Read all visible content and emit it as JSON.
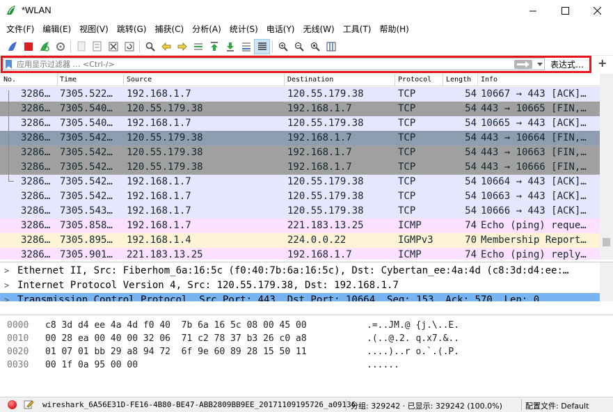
{
  "window": {
    "title": "*WLAN",
    "minimize": "minimize",
    "maximize": "maximize",
    "close": "close"
  },
  "menu": [
    "文件(F)",
    "编辑(E)",
    "视图(V)",
    "跳转(G)",
    "捕获(C)",
    "分析(A)",
    "统计(S)",
    "电话(Y)",
    "无线(W)",
    "工具(T)",
    "帮助(H)"
  ],
  "filter": {
    "placeholder": "应用显示过滤器 … <Ctrl-/>",
    "expression_label": "表达式…",
    "add_label": "+"
  },
  "packet_list": {
    "columns": [
      "No.",
      "Time",
      "Source",
      "Destination",
      "Protocol",
      "Length",
      "Info"
    ],
    "rows": [
      {
        "no": "3286…",
        "time": "7305.522…",
        "src": "192.168.1.7",
        "dst": "120.55.179.38",
        "proto": "TCP",
        "len": "54",
        "info": "10667 → 443 [ACK]…",
        "bg": "#e7e6ff",
        "fg": "#12272e"
      },
      {
        "no": "3286…",
        "time": "7305.540…",
        "src": "120.55.179.38",
        "dst": "192.168.1.7",
        "proto": "TCP",
        "len": "54",
        "info": "443 → 10665 [FIN,…",
        "bg": "#a0a0a0",
        "fg": "#12272e"
      },
      {
        "no": "3286…",
        "time": "7305.540…",
        "src": "192.168.1.7",
        "dst": "120.55.179.38",
        "proto": "TCP",
        "len": "54",
        "info": "10665 → 443 [ACK]…",
        "bg": "#e7e6ff",
        "fg": "#12272e"
      },
      {
        "no": "3286…",
        "time": "7305.542…",
        "src": "120.55.179.38",
        "dst": "192.168.1.7",
        "proto": "TCP",
        "len": "54",
        "info": "443 → 10664 [FIN,…",
        "bg": "#8c9eb0",
        "fg": "#12272e"
      },
      {
        "no": "3286…",
        "time": "7305.542…",
        "src": "120.55.179.38",
        "dst": "192.168.1.7",
        "proto": "TCP",
        "len": "54",
        "info": "443 → 10663 [FIN,…",
        "bg": "#a0a0a0",
        "fg": "#12272e"
      },
      {
        "no": "3286…",
        "time": "7305.542…",
        "src": "120.55.179.38",
        "dst": "192.168.1.7",
        "proto": "TCP",
        "len": "54",
        "info": "443 → 10666 [FIN,…",
        "bg": "#a0a0a0",
        "fg": "#12272e"
      },
      {
        "no": "3286…",
        "time": "7305.542…",
        "src": "192.168.1.7",
        "dst": "120.55.179.38",
        "proto": "TCP",
        "len": "54",
        "info": "10664 → 443 [ACK]…",
        "bg": "#e7e6ff",
        "fg": "#12272e"
      },
      {
        "no": "3286…",
        "time": "7305.542…",
        "src": "192.168.1.7",
        "dst": "120.55.179.38",
        "proto": "TCP",
        "len": "54",
        "info": "10663 → 443 [ACK]…",
        "bg": "#e7e6ff",
        "fg": "#12272e"
      },
      {
        "no": "3286…",
        "time": "7305.543…",
        "src": "192.168.1.7",
        "dst": "120.55.179.38",
        "proto": "TCP",
        "len": "54",
        "info": "10666 → 443 [ACK]…",
        "bg": "#e7e6ff",
        "fg": "#12272e"
      },
      {
        "no": "3286…",
        "time": "7305.858…",
        "src": "192.168.1.7",
        "dst": "221.183.13.25",
        "proto": "ICMP",
        "len": "74",
        "info": "Echo (ping) reque…",
        "bg": "#fce0ff",
        "fg": "#12272e"
      },
      {
        "no": "3286…",
        "time": "7305.895…",
        "src": "192.168.1.4",
        "dst": "224.0.0.22",
        "proto": "IGMPv3",
        "len": "70",
        "info": "Membership Report…",
        "bg": "#fff3d6",
        "fg": "#12272e"
      },
      {
        "no": "3286…",
        "time": "7305.901…",
        "src": "221.183.13.25",
        "dst": "192.168.1.7",
        "proto": "ICMP",
        "len": "74",
        "info": "Echo (ping) reply…",
        "bg": "#fce0ff",
        "fg": "#12272e"
      }
    ]
  },
  "details": [
    {
      "arrow": ">",
      "text": "Ethernet II, Src: Fiberhom_6a:16:5c (f0:40:7b:6a:16:5c), Dst: Cybertan_ee:4a:4d (c8:3d:d4:ee:…",
      "selected": false
    },
    {
      "arrow": ">",
      "text": "Internet Protocol Version 4, Src: 120.55.179.38, Dst: 192.168.1.7",
      "selected": false
    },
    {
      "arrow": ">",
      "text": "Transmission Control Protocol, Src Port: 443, Dst Port: 10664, Seq: 153, Ack: 570, Len: 0",
      "selected": true
    }
  ],
  "bytes": [
    {
      "offset": "0000",
      "hex": "c8 3d d4 ee 4a 4d f0 40  7b 6a 16 5c 08 00 45 00",
      "ascii": ".=..JM.@ {j.\\..E."
    },
    {
      "offset": "0010",
      "hex": "00 28 ea 00 40 00 32 06  71 c2 78 37 b3 26 c0 a8",
      "ascii": ".(..@.2. q.x7.&.."
    },
    {
      "offset": "0020",
      "hex": "01 07 01 bb 29 a8 94 72  6f 9e 60 89 28 15 50 11",
      "ascii": "....)..r o.`.(.P."
    },
    {
      "offset": "0030",
      "hex": "00 1f 0a 95 00 00",
      "ascii": "......"
    }
  ],
  "status": {
    "file": "wireshark_6A56E31D-FE16-4B80-BE47-ABB2809BB9EE_20171109195726_a09136",
    "packets": "分组: 329242 · 已显示: 329242 (100.0%)",
    "profile": "配置文件: Default"
  }
}
